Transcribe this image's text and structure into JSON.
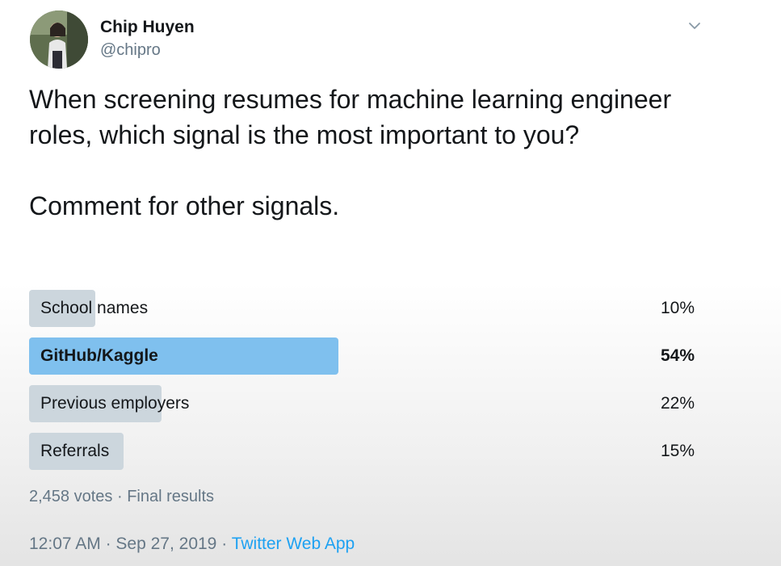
{
  "author": {
    "name": "Chip Huyen",
    "handle": "@chipro"
  },
  "tweet": {
    "text_line1": "When screening resumes for machine learning engineer roles, which signal is the most important to you?",
    "text_line2": "Comment for other signals."
  },
  "poll": {
    "options": [
      {
        "label": "School names",
        "percent": "10%",
        "fraction": 0.1,
        "winner": false
      },
      {
        "label": "GitHub/Kaggle",
        "percent": "54%",
        "fraction": 0.54,
        "winner": true
      },
      {
        "label": "Previous employers",
        "percent": "22%",
        "fraction": 0.22,
        "winner": false
      },
      {
        "label": "Referrals",
        "percent": "15%",
        "fraction": 0.15,
        "winner": false
      }
    ],
    "votes": "2,458 votes",
    "separator": "·",
    "status": "Final results"
  },
  "footer": {
    "time": "12:07 AM",
    "separator": "·",
    "date": "Sep 27, 2019",
    "source": "Twitter Web App"
  },
  "colors": {
    "winner_bar": "#7fc0ee",
    "other_bar": "#ccd6dd",
    "link": "#1da1f2",
    "secondary_text": "#657786"
  },
  "icons": {
    "menu": "chevron-down-icon",
    "avatar": "profile-photo"
  }
}
